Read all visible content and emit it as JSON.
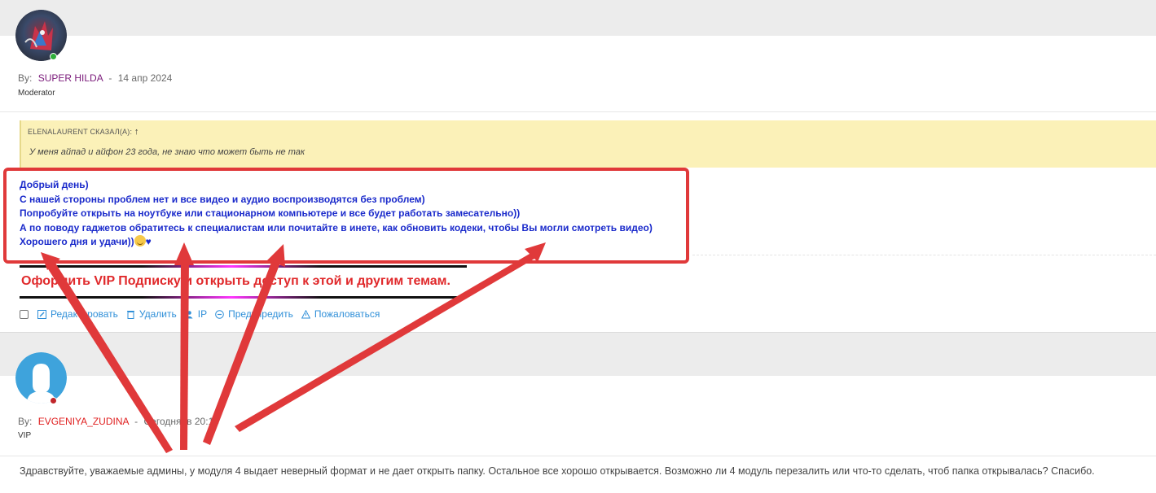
{
  "post1": {
    "by_label": "By:",
    "username": "SUPER HILDA",
    "username_color": "#7a1a7a",
    "date_sep": "-",
    "date": "14 апр 2024",
    "role": "Moderator",
    "status_color": "#2fae3a",
    "quote": {
      "author": "ELENALAURENT СКАЗАЛ(А):",
      "arrow": "↑",
      "text": "У меня айпад и айфон 23 года, не знаю что может быть не так"
    },
    "reply_lines": [
      "Добрый день)",
      "С нашей стороны проблем нет и все видео и аудио воспроизводятся без проблем)",
      "Попробуйте открыть на ноутбуке или стационарном компьютере и все будет работать замесательно))",
      "А по поводу гаджетов обратитесь к специалистам или почитайте в инете, как обновить кодеки, чтобы Вы могли смотреть видео)",
      "Хорошего дня и удачи))"
    ],
    "reply_suffix_heart": "♥",
    "vip_banner": "Оформить VIP Подписку и открыть доступ к этой и другим темам.",
    "actions": {
      "edit": "Редактировать",
      "delete": "Удалить",
      "ip": "IP",
      "warn": "Предупредить",
      "report": "Пожаловаться"
    }
  },
  "post2": {
    "by_label": "By:",
    "username": "EVGENIYA_ZUDINA",
    "username_color": "#e02020",
    "date_sep": "-",
    "date": "Сегодня, в 20:15",
    "role": "VIP",
    "status_color": "#c0262a",
    "text": "Здравствуйте, уважаемые админы, у модуля 4 выдает неверный формат и не дает открыть папку. Остальное все хорошо открывается. Возможно ли 4 модуль перезалить или что-то сделать, чтоб папка открывалась? Спасибо."
  },
  "colors": {
    "link": "#2f8fd8",
    "reply_text": "#1a2acb",
    "annotation": "#e0393a",
    "quote_bg": "#fbf1b8"
  }
}
